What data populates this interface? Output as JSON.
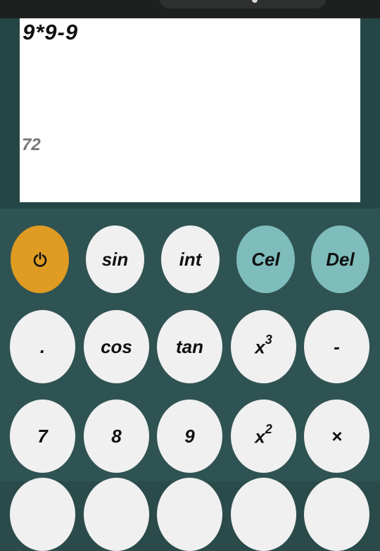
{
  "display": {
    "expression": "9*9-9",
    "result": "72"
  },
  "keys": {
    "row1": [
      {
        "label": "",
        "icon": "power-icon"
      },
      {
        "label": "sin"
      },
      {
        "label": "int"
      },
      {
        "label": "Cel"
      },
      {
        "label": "Del"
      }
    ],
    "row2": [
      {
        "label": "."
      },
      {
        "label": "cos"
      },
      {
        "label": "tan"
      },
      {
        "base": "x",
        "exp": "3"
      },
      {
        "label": "-"
      }
    ],
    "row3": [
      {
        "label": "7"
      },
      {
        "label": "8"
      },
      {
        "label": "9"
      },
      {
        "base": "x",
        "exp": "2"
      },
      {
        "label": "×"
      }
    ]
  },
  "colors": {
    "power_key": "#df9b22",
    "clear_keys": "#7fbcbc",
    "number_keys": "#f0f0f0",
    "keypad_background": "#2f5352"
  }
}
